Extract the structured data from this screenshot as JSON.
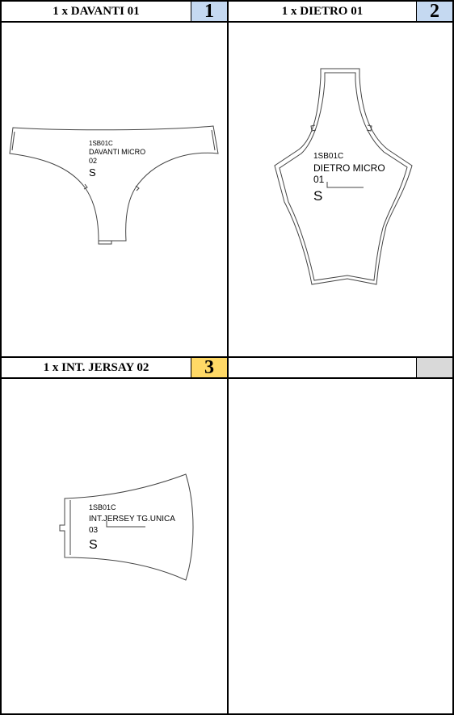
{
  "cells": [
    {
      "title": "1 x DAVANTI 01",
      "number": "1",
      "number_bg": "#c5d9f1",
      "piece": {
        "code": "1SB01C",
        "name": "DAVANTI MICRO",
        "idx": "02",
        "size": "S"
      }
    },
    {
      "title": "1 x DIETRO 01",
      "number": "2",
      "number_bg": "#c5d9f1",
      "piece": {
        "code": "1SB01C",
        "name": "DIETRO MICRO",
        "idx": "01",
        "size": "S"
      }
    },
    {
      "title": "1 x INT. JERSAY 02",
      "number": "3",
      "number_bg": "#ffd966",
      "piece": {
        "code": "1SB01C",
        "name": "INT.JERSEY TG.UNICA",
        "idx": "03",
        "size": "S"
      }
    },
    {
      "title": "",
      "number": "",
      "number_bg": "#d9d9d9"
    }
  ]
}
